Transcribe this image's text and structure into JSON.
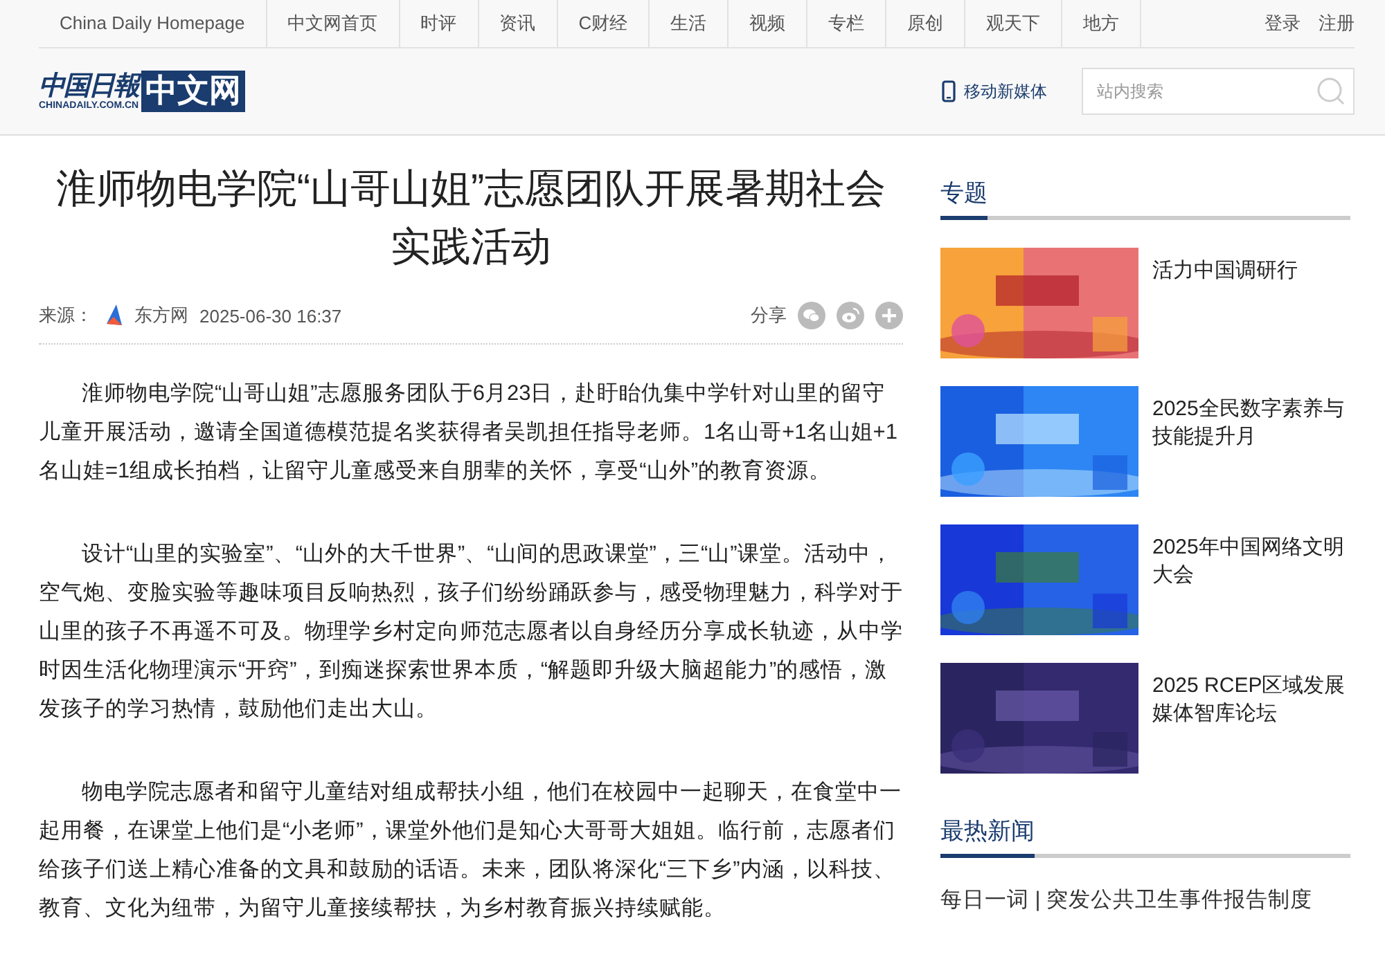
{
  "top_nav": {
    "items": [
      {
        "label": "China Daily Homepage"
      },
      {
        "label": "中文网首页"
      },
      {
        "label": "时评"
      },
      {
        "label": "资讯"
      },
      {
        "label": "C财经"
      },
      {
        "label": "生活"
      },
      {
        "label": "视频"
      },
      {
        "label": "专栏"
      },
      {
        "label": "原创"
      },
      {
        "label": "观天下"
      },
      {
        "label": "地方"
      }
    ],
    "account": [
      "登录",
      "注册"
    ]
  },
  "header": {
    "logo": {
      "cn": "中国日報",
      "domain": "CHINADAILY.COM.CN",
      "site": "中文网"
    },
    "mobile_link": "移动新媒体",
    "search": {
      "placeholder": "站内搜索"
    }
  },
  "article": {
    "title": "淮师物电学院“山哥山姐”志愿团队开展暑期社会实践活动",
    "source_label": "来源：",
    "source": "东方网",
    "date": "2025-06-30 16:37",
    "share_label": "分享",
    "paragraphs": [
      "淮师物电学院“山哥山姐”志愿服务团队于6月23日，赴盱眙仇集中学针对山里的留守儿童开展活动，邀请全国道德模范提名奖获得者吴凯担任指导老师。1名山哥+1名山姐+1名山娃=1组成长拍档，让留守儿童感受来自朋辈的关怀，享受“山外”的教育资源。",
      "设计“山里的实验室”、“山外的大千世界”、“山间的思政课堂”，三“山”课堂。活动中，空气炮、变脸实验等趣味项目反响热烈，孩子们纷纷踊跃参与，感受物理魅力，科学对于山里的孩子不再遥不可及。物理学乡村定向师范志愿者以自身经历分享成长轨迹，从中学时因生活化物理演示“开窍”，到痴迷探索世界本质，“解题即升级大脑超能力”的感悟，激发孩子的学习热情，鼓励他们走出大山。",
      "物电学院志愿者和留守儿童结对组成帮扶小组，他们在校园中一起聊天，在食堂中一起用餐，在课堂上他们是“小老师”，课堂外他们是知心大哥哥大姐姐。临行前，志愿者们给孩子们送上精心准备的文具和鼓励的话语。未来，团队将深化“三下乡”内涵，以科技、教育、文化为纽带，为留守儿童接续帮扶，为乡村教育振兴持续赋能。"
    ]
  },
  "sidebar": {
    "topics_title": "专题",
    "topics": [
      {
        "title": "活力中国调研行",
        "kind": "picture"
      },
      {
        "title": "2025全民数字素养与技能提升月",
        "kind": "picture"
      },
      {
        "title": "2025年中国网络文明大会",
        "kind": "picture"
      },
      {
        "title": "2025 RCEP区域发展媒体智库论坛",
        "kind": "picture"
      }
    ],
    "hot_title": "最热新闻",
    "hot": [
      "每日一词 | 突发公共卫生事件报告制度"
    ]
  }
}
